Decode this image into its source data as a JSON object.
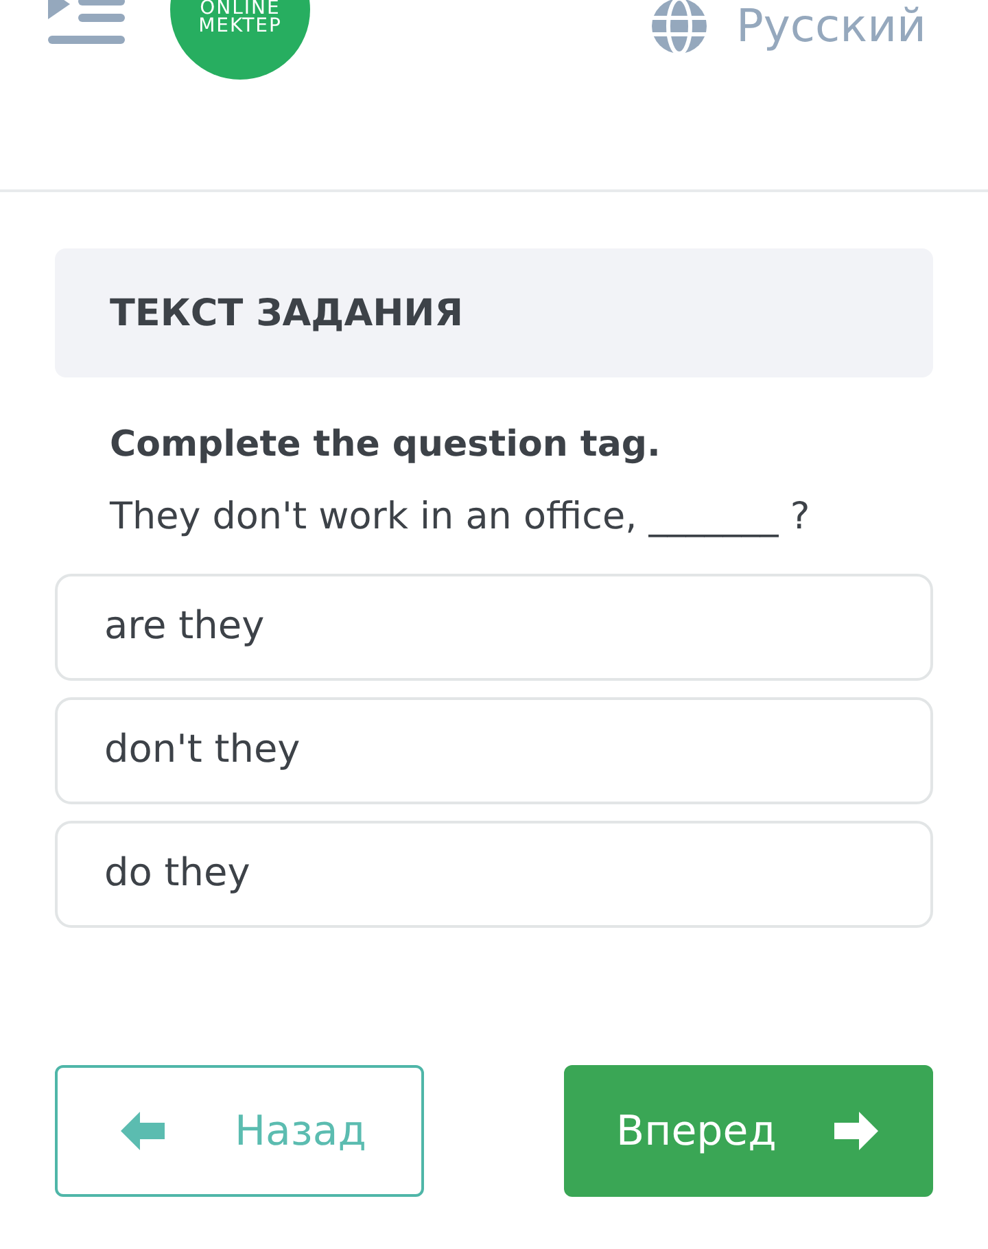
{
  "header": {
    "logo": {
      "line1": "ONLINE",
      "line2": "MEKTEP"
    },
    "language": "Русский"
  },
  "task": {
    "heading": "ТЕКСТ ЗАДАНИЯ",
    "instruction": "Complete the question tag.",
    "sentence": "They don't work in an office, _______ ?"
  },
  "options": [
    {
      "label": "are they",
      "selected": false
    },
    {
      "label": "don't they",
      "selected": false
    },
    {
      "label": "do they",
      "selected": false
    }
  ],
  "nav": {
    "back": "Назад",
    "next": "Вперед"
  }
}
